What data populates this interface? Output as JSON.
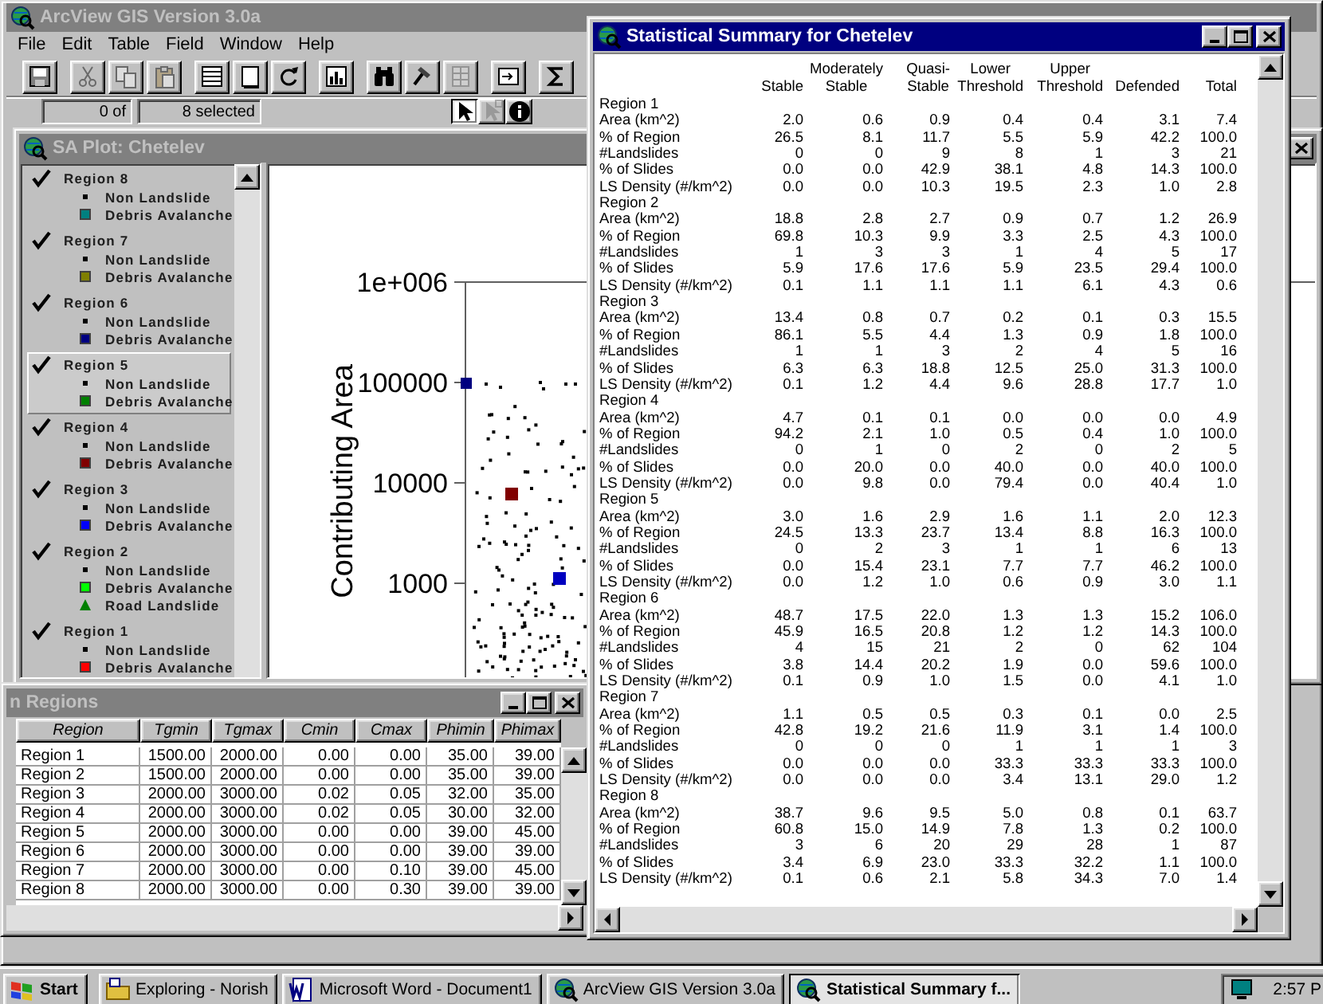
{
  "app": {
    "title": "ArcView GIS Version 3.0a",
    "menu": [
      "File",
      "Edit",
      "Table",
      "Field",
      "Window",
      "Help"
    ],
    "toolbar": [
      [
        {
          "kind": "save",
          "disabled": false
        }
      ],
      [
        {
          "kind": "cut",
          "disabled": true
        },
        {
          "kind": "copy",
          "disabled": true
        },
        {
          "kind": "paste",
          "disabled": true
        }
      ],
      [
        {
          "kind": "table",
          "disabled": false
        },
        {
          "kind": "page",
          "disabled": false
        },
        {
          "kind": "refresh",
          "disabled": false
        }
      ],
      [
        {
          "kind": "chart",
          "disabled": false
        }
      ],
      [
        {
          "kind": "find",
          "disabled": false
        },
        {
          "kind": "query",
          "disabled": false
        },
        {
          "kind": "grid",
          "disabled": true
        }
      ],
      [
        {
          "kind": "promote",
          "disabled": false
        }
      ],
      [
        {
          "kind": "sum",
          "disabled": false
        }
      ]
    ],
    "record_count": "0 of",
    "selection": "8 selected",
    "tools": [
      {
        "kind": "pointer",
        "selected": true,
        "disabled": false
      },
      {
        "kind": "vertex",
        "selected": false,
        "disabled": true
      },
      {
        "kind": "identify",
        "selected": false,
        "disabled": false
      }
    ]
  },
  "plot_window": {
    "title": "SA Plot: Chetelev",
    "legend": [
      {
        "label": "Region 8",
        "checked": true,
        "selected": false,
        "symbols": [
          {
            "kind": "dot",
            "label": "Non Landslide"
          },
          {
            "kind": "square",
            "label": "Debris Avalanche",
            "color": "#008080"
          }
        ]
      },
      {
        "label": "Region 7",
        "checked": true,
        "selected": false,
        "symbols": [
          {
            "kind": "dot",
            "label": "Non Landslide"
          },
          {
            "kind": "square",
            "label": "Debris Avalanche",
            "color": "#808000"
          }
        ]
      },
      {
        "label": "Region 6",
        "checked": true,
        "selected": false,
        "symbols": [
          {
            "kind": "dot",
            "label": "Non Landslide"
          },
          {
            "kind": "square",
            "label": "Debris Avalanche",
            "color": "#000080"
          }
        ]
      },
      {
        "label": "Region 5",
        "checked": true,
        "selected": true,
        "symbols": [
          {
            "kind": "dot",
            "label": "Non Landslide"
          },
          {
            "kind": "square",
            "label": "Debris Avalanche",
            "color": "#008000"
          }
        ]
      },
      {
        "label": "Region 4",
        "checked": true,
        "selected": false,
        "symbols": [
          {
            "kind": "dot",
            "label": "Non Landslide"
          },
          {
            "kind": "square",
            "label": "Debris Avalanche",
            "color": "#800000"
          }
        ]
      },
      {
        "label": "Region 3",
        "checked": true,
        "selected": false,
        "symbols": [
          {
            "kind": "dot",
            "label": "Non Landslide"
          },
          {
            "kind": "square",
            "label": "Debris Avalanche",
            "color": "#0000ff"
          }
        ]
      },
      {
        "label": "Region 2",
        "checked": true,
        "selected": false,
        "symbols": [
          {
            "kind": "dot",
            "label": "Non Landslide"
          },
          {
            "kind": "square",
            "label": "Debris Avalanche",
            "color": "#00ff00"
          },
          {
            "kind": "triangle",
            "label": "Road Landslide",
            "color": "#008000"
          }
        ]
      },
      {
        "label": "Region 1",
        "checked": true,
        "selected": false,
        "symbols": [
          {
            "kind": "dot",
            "label": "Non Landslide"
          },
          {
            "kind": "square",
            "label": "Debris Avalanche",
            "color": "#ff0000"
          }
        ]
      }
    ],
    "y_label": "Contributing Area",
    "y_ticks": [
      "1e+006",
      "100000",
      "10000",
      "1000"
    ]
  },
  "regions_window": {
    "title": "n Regions",
    "columns": [
      "Region",
      "Tgmin",
      "Tgmax",
      "Cmin",
      "Cmax",
      "Phimin",
      "Phimax"
    ],
    "rows": [
      [
        "Region 1",
        "1500.00",
        "2000.00",
        "0.00",
        "0.00",
        "35.00",
        "39.00"
      ],
      [
        "Region 2",
        "1500.00",
        "2000.00",
        "0.00",
        "0.00",
        "35.00",
        "39.00"
      ],
      [
        "Region 3",
        "2000.00",
        "3000.00",
        "0.02",
        "0.05",
        "32.00",
        "35.00"
      ],
      [
        "Region 4",
        "2000.00",
        "3000.00",
        "0.02",
        "0.05",
        "30.00",
        "32.00"
      ],
      [
        "Region 5",
        "2000.00",
        "3000.00",
        "0.00",
        "0.00",
        "39.00",
        "45.00"
      ],
      [
        "Region 6",
        "2000.00",
        "3000.00",
        "0.00",
        "0.00",
        "39.00",
        "39.00"
      ],
      [
        "Region 7",
        "2000.00",
        "3000.00",
        "0.00",
        "0.10",
        "39.00",
        "45.00"
      ],
      [
        "Region 8",
        "2000.00",
        "3000.00",
        "0.00",
        "0.30",
        "39.00",
        "39.00"
      ]
    ]
  },
  "stats_window": {
    "title": "Statistical Summary for Chetelev",
    "columns": [
      [
        "Stable"
      ],
      [
        "Moderately",
        "Stable"
      ],
      [
        "Quasi-",
        "Stable"
      ],
      [
        "Lower",
        "Threshold"
      ],
      [
        "Upper",
        "Threshold"
      ],
      [
        "Defended"
      ],
      [
        "Total"
      ]
    ],
    "sections": [
      {
        "title": "Region 1",
        "rows": [
          {
            "label": "Area (km^2)",
            "values": [
              "2.0",
              "0.6",
              "0.9",
              "0.4",
              "0.4",
              "3.1",
              "7.4"
            ]
          },
          {
            "label": "% of Region",
            "values": [
              "26.5",
              "8.1",
              "11.7",
              "5.5",
              "5.9",
              "42.2",
              "100.0"
            ]
          },
          {
            "label": "#Landslides",
            "values": [
              "0",
              "0",
              "9",
              "8",
              "1",
              "3",
              "21"
            ]
          },
          {
            "label": "% of Slides",
            "values": [
              "0.0",
              "0.0",
              "42.9",
              "38.1",
              "4.8",
              "14.3",
              "100.0"
            ]
          },
          {
            "label": "LS Density (#/km^2)",
            "values": [
              "0.0",
              "0.0",
              "10.3",
              "19.5",
              "2.3",
              "1.0",
              "2.8"
            ]
          }
        ]
      },
      {
        "title": "Region 2",
        "rows": [
          {
            "label": "Area (km^2)",
            "values": [
              "18.8",
              "2.8",
              "2.7",
              "0.9",
              "0.7",
              "1.2",
              "26.9"
            ]
          },
          {
            "label": "% of Region",
            "values": [
              "69.8",
              "10.3",
              "9.9",
              "3.3",
              "2.5",
              "4.3",
              "100.0"
            ]
          },
          {
            "label": "#Landslides",
            "values": [
              "1",
              "3",
              "3",
              "1",
              "4",
              "5",
              "17"
            ]
          },
          {
            "label": "% of Slides",
            "values": [
              "5.9",
              "17.6",
              "17.6",
              "5.9",
              "23.5",
              "29.4",
              "100.0"
            ]
          },
          {
            "label": "LS Density (#/km^2)",
            "values": [
              "0.1",
              "1.1",
              "1.1",
              "1.1",
              "6.1",
              "4.3",
              "0.6"
            ]
          }
        ]
      },
      {
        "title": "Region 3",
        "rows": [
          {
            "label": "Area (km^2)",
            "values": [
              "13.4",
              "0.8",
              "0.7",
              "0.2",
              "0.1",
              "0.3",
              "15.5"
            ]
          },
          {
            "label": "% of Region",
            "values": [
              "86.1",
              "5.5",
              "4.4",
              "1.3",
              "0.9",
              "1.8",
              "100.0"
            ]
          },
          {
            "label": "#Landslides",
            "values": [
              "1",
              "1",
              "3",
              "2",
              "4",
              "5",
              "16"
            ]
          },
          {
            "label": "% of Slides",
            "values": [
              "6.3",
              "6.3",
              "18.8",
              "12.5",
              "25.0",
              "31.3",
              "100.0"
            ]
          },
          {
            "label": "LS Density (#/km^2)",
            "values": [
              "0.1",
              "1.2",
              "4.4",
              "9.6",
              "28.8",
              "17.7",
              "1.0"
            ]
          }
        ]
      },
      {
        "title": "Region 4",
        "rows": [
          {
            "label": "Area (km^2)",
            "values": [
              "4.7",
              "0.1",
              "0.1",
              "0.0",
              "0.0",
              "0.0",
              "4.9"
            ]
          },
          {
            "label": "% of Region",
            "values": [
              "94.2",
              "2.1",
              "1.0",
              "0.5",
              "0.4",
              "1.0",
              "100.0"
            ]
          },
          {
            "label": "#Landslides",
            "values": [
              "0",
              "1",
              "0",
              "2",
              "0",
              "2",
              "5"
            ]
          },
          {
            "label": "% of Slides",
            "values": [
              "0.0",
              "20.0",
              "0.0",
              "40.0",
              "0.0",
              "40.0",
              "100.0"
            ]
          },
          {
            "label": "LS Density (#/km^2)",
            "values": [
              "0.0",
              "9.8",
              "0.0",
              "79.4",
              "0.0",
              "40.4",
              "1.0"
            ]
          }
        ]
      },
      {
        "title": "Region 5",
        "rows": [
          {
            "label": "Area (km^2)",
            "values": [
              "3.0",
              "1.6",
              "2.9",
              "1.6",
              "1.1",
              "2.0",
              "12.3"
            ]
          },
          {
            "label": "% of Region",
            "values": [
              "24.5",
              "13.3",
              "23.7",
              "13.4",
              "8.8",
              "16.3",
              "100.0"
            ]
          },
          {
            "label": "#Landslides",
            "values": [
              "0",
              "2",
              "3",
              "1",
              "1",
              "6",
              "13"
            ]
          },
          {
            "label": "% of Slides",
            "values": [
              "0.0",
              "15.4",
              "23.1",
              "7.7",
              "7.7",
              "46.2",
              "100.0"
            ]
          },
          {
            "label": "LS Density (#/km^2)",
            "values": [
              "0.0",
              "1.2",
              "1.0",
              "0.6",
              "0.9",
              "3.0",
              "1.1"
            ]
          }
        ]
      },
      {
        "title": "Region 6",
        "rows": [
          {
            "label": "Area (km^2)",
            "values": [
              "48.7",
              "17.5",
              "22.0",
              "1.3",
              "1.3",
              "15.2",
              "106.0"
            ]
          },
          {
            "label": "% of Region",
            "values": [
              "45.9",
              "16.5",
              "20.8",
              "1.2",
              "1.2",
              "14.3",
              "100.0"
            ]
          },
          {
            "label": "#Landslides",
            "values": [
              "4",
              "15",
              "21",
              "2",
              "0",
              "62",
              "104"
            ]
          },
          {
            "label": "% of Slides",
            "values": [
              "3.8",
              "14.4",
              "20.2",
              "1.9",
              "0.0",
              "59.6",
              "100.0"
            ]
          },
          {
            "label": "LS Density (#/km^2)",
            "values": [
              "0.1",
              "0.9",
              "1.0",
              "1.5",
              "0.0",
              "4.1",
              "1.0"
            ]
          }
        ]
      },
      {
        "title": "Region 7",
        "rows": [
          {
            "label": "Area (km^2)",
            "values": [
              "1.1",
              "0.5",
              "0.5",
              "0.3",
              "0.1",
              "0.0",
              "2.5"
            ]
          },
          {
            "label": "% of Region",
            "values": [
              "42.8",
              "19.2",
              "21.6",
              "11.9",
              "3.1",
              "1.4",
              "100.0"
            ]
          },
          {
            "label": "#Landslides",
            "values": [
              "0",
              "0",
              "0",
              "1",
              "1",
              "1",
              "3"
            ]
          },
          {
            "label": "% of Slides",
            "values": [
              "0.0",
              "0.0",
              "0.0",
              "33.3",
              "33.3",
              "33.3",
              "100.0"
            ]
          },
          {
            "label": "LS Density (#/km^2)",
            "values": [
              "0.0",
              "0.0",
              "0.0",
              "3.4",
              "13.1",
              "29.0",
              "1.2"
            ]
          }
        ]
      },
      {
        "title": "Region 8",
        "rows": [
          {
            "label": "Area (km^2)",
            "values": [
              "38.7",
              "9.6",
              "9.5",
              "5.0",
              "0.8",
              "0.1",
              "63.7"
            ]
          },
          {
            "label": "% of Region",
            "values": [
              "60.8",
              "15.0",
              "14.9",
              "7.8",
              "1.3",
              "0.2",
              "100.0"
            ]
          },
          {
            "label": "#Landslides",
            "values": [
              "3",
              "6",
              "20",
              "29",
              "28",
              "1",
              "87"
            ]
          },
          {
            "label": "% of Slides",
            "values": [
              "3.4",
              "6.9",
              "23.0",
              "33.3",
              "32.2",
              "1.1",
              "100.0"
            ]
          },
          {
            "label": "LS Density (#/km^2)",
            "values": [
              "0.1",
              "0.6",
              "2.1",
              "5.8",
              "34.3",
              "7.0",
              "1.4"
            ]
          }
        ]
      }
    ]
  },
  "taskbar": {
    "start": "Start",
    "tasks": [
      {
        "kind": "explorer",
        "label": "Exploring - Norish",
        "selected": false
      },
      {
        "kind": "word",
        "label": "Microsoft Word - Document1",
        "selected": false
      },
      {
        "kind": "arcview",
        "label": "ArcView GIS Version 3.0a",
        "selected": false
      },
      {
        "kind": "arcview",
        "label": "Statistical Summary f...",
        "selected": true
      }
    ],
    "clock": "2:57 P"
  }
}
